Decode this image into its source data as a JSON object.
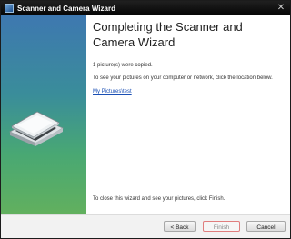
{
  "window": {
    "title": "Scanner and Camera Wizard",
    "close_glyph": "✕",
    "accent_gradient": [
      "#3e78b0",
      "#62b05e"
    ]
  },
  "main": {
    "heading": "Completing the Scanner and Camera Wizard",
    "copied_text": "1 picture(s) were copied.",
    "instruction_text": "To see your pictures on your computer or network, click the location below.",
    "location_link": "My Pictures\\test",
    "close_instruction": "To close this wizard and see your pictures, click Finish."
  },
  "buttons": {
    "back": "< Back",
    "finish": "Finish",
    "cancel": "Cancel"
  }
}
